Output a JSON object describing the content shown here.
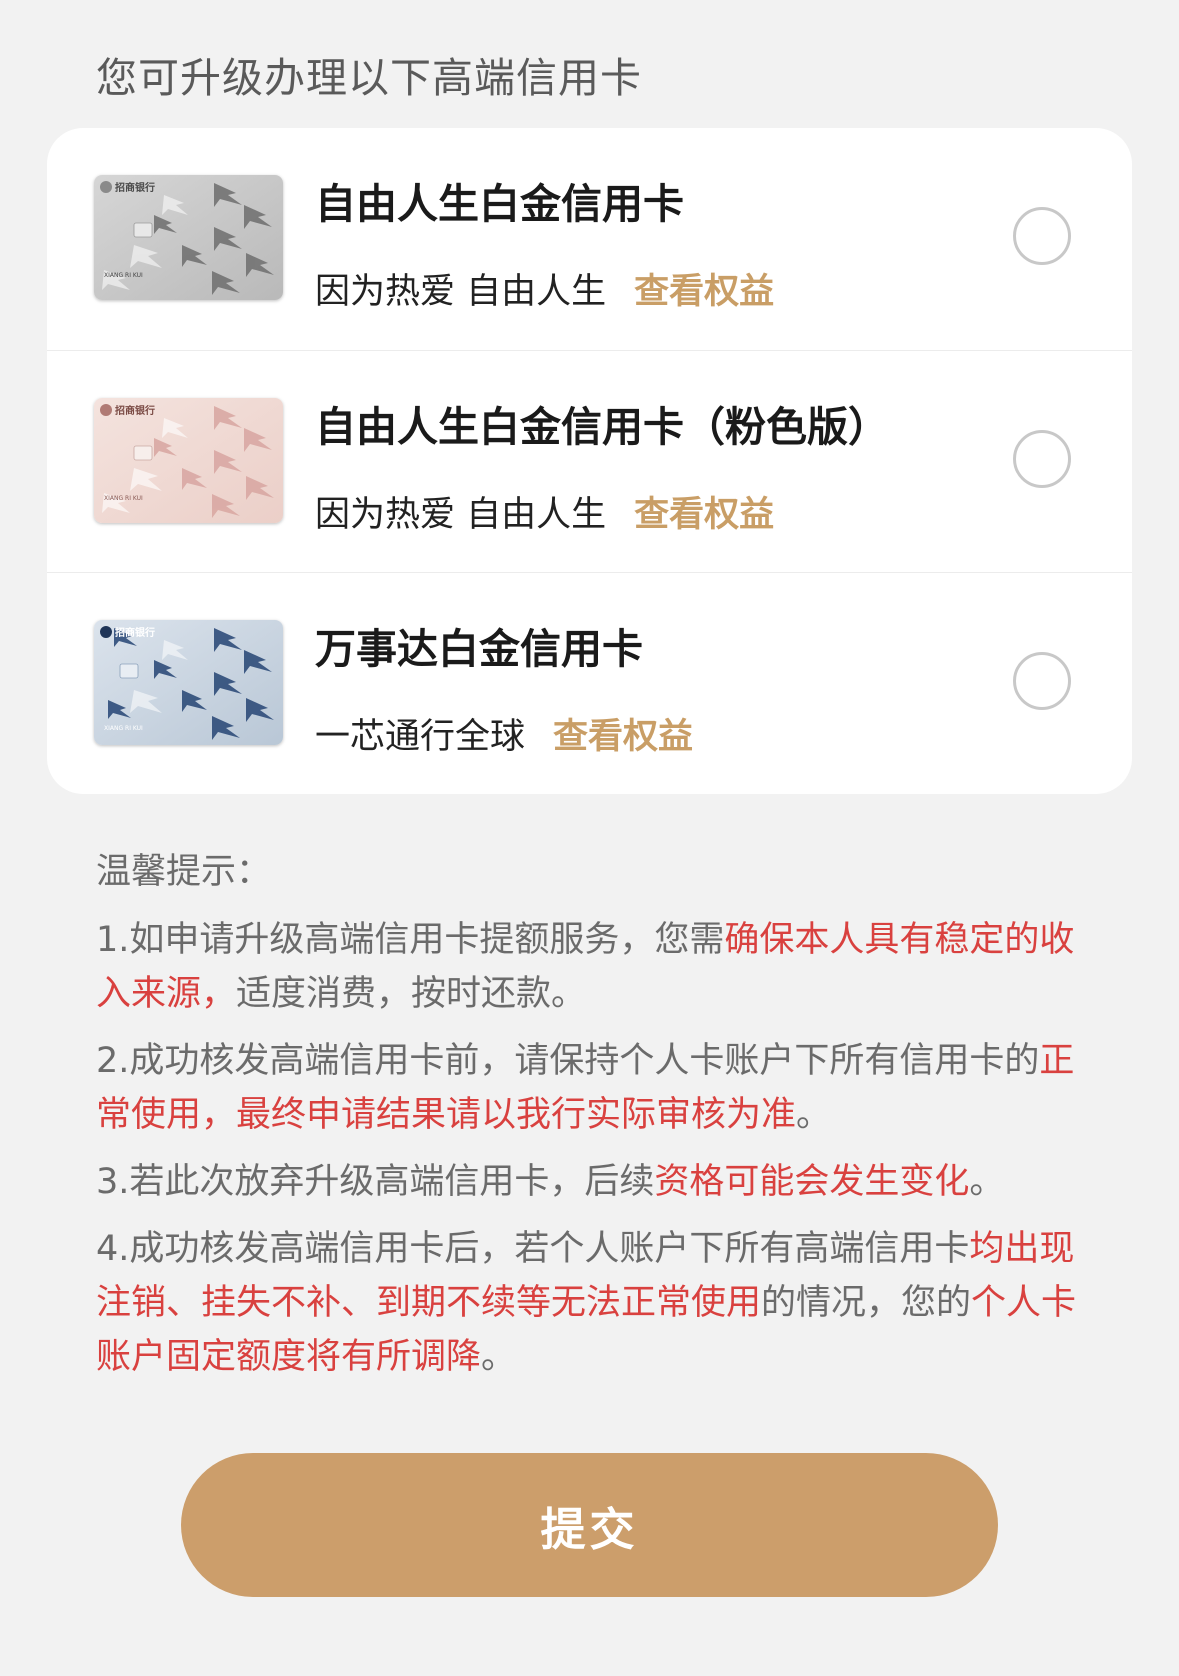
{
  "section_heading": "您可升级办理以下高端信用卡",
  "colors": {
    "accent": "#c99e66",
    "highlight": "#d9413f",
    "submit_bg": "#cc9e6b"
  },
  "cards": [
    {
      "title": "自由人生白金信用卡",
      "subtitle": "因为热爱 自由人生",
      "benefits_link": "查看权益",
      "selected": false,
      "card_face": {
        "bank_name": "招商银行",
        "holder": "XIANG RI KUI",
        "theme": "silver"
      }
    },
    {
      "title": "自由人生白金信用卡（粉色版）",
      "subtitle": "因为热爱 自由人生",
      "benefits_link": "查看权益",
      "selected": false,
      "card_face": {
        "bank_name": "招商银行",
        "holder": "XIANG RI KUI",
        "theme": "pink"
      }
    },
    {
      "title": "万事达白金信用卡",
      "subtitle": "一芯通行全球",
      "benefits_link": "查看权益",
      "selected": false,
      "card_face": {
        "bank_name": "招商银行",
        "holder": "XIANG RI KUI",
        "theme": "blue"
      }
    }
  ],
  "tips": {
    "title": "温馨提示：",
    "items": [
      [
        {
          "text": "1.如申请升级高端信用卡提额服务，您需",
          "highlight": false
        },
        {
          "text": "确保本人具有稳定的收入来源，",
          "highlight": true
        },
        {
          "text": "适度消费，按时还款。",
          "highlight": false
        }
      ],
      [
        {
          "text": "2.成功核发高端信用卡前，请保持个人卡账户下所有信用卡的",
          "highlight": false
        },
        {
          "text": "正常使用，最终申请结果请以我行实际审核为准",
          "highlight": true
        },
        {
          "text": "。",
          "highlight": false
        }
      ],
      [
        {
          "text": "3.若此次放弃升级高端信用卡，后续",
          "highlight": false
        },
        {
          "text": "资格可能会发生变化",
          "highlight": true
        },
        {
          "text": "。",
          "highlight": false
        }
      ],
      [
        {
          "text": "4.成功核发高端信用卡后，若个人账户下所有高端信用卡",
          "highlight": false
        },
        {
          "text": "均出现注销、挂失不补、到期不续等无法正常使用",
          "highlight": true
        },
        {
          "text": "的情况，您的",
          "highlight": false
        },
        {
          "text": "个人卡账户固定额度将有所调降",
          "highlight": true
        },
        {
          "text": "。",
          "highlight": false
        }
      ]
    ]
  },
  "submit_label": "提交"
}
